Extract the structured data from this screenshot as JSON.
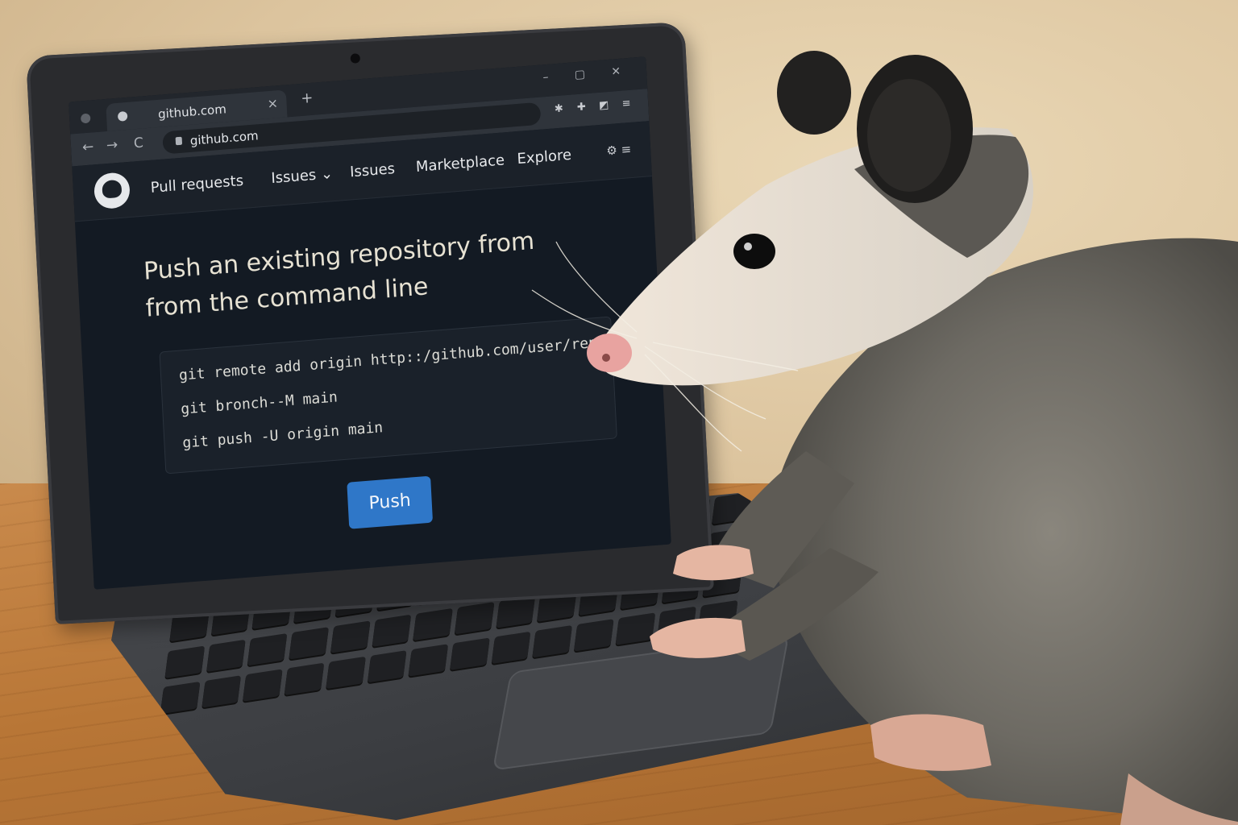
{
  "browser": {
    "tab_title": "github.com",
    "tab_close": "×",
    "new_tab": "+",
    "window_controls": "– ▢ ✕",
    "address": "github.com",
    "nav_back": "←",
    "nav_forward": "→",
    "nav_reload": "C"
  },
  "github_nav": {
    "items": [
      "Pull requests",
      "Issues ⌄",
      "Issues",
      "Marketplace",
      "Explore"
    ]
  },
  "main": {
    "title_line1": "Push an existing repository from",
    "title_line2": "from the command line",
    "code_lines": [
      "git remote add origin http::/github.com/user/repo.git",
      "git bronch--M main",
      "git push  -U origin main"
    ],
    "push_label": "Push"
  },
  "colors": {
    "screen_bg": "#131a23",
    "push_button": "#2f77c8",
    "title_text": "#e7e2d3",
    "opossum_fur": "#6d6a63",
    "opossum_face": "#ece6da"
  },
  "icons": [
    "github-logo-icon",
    "lock-icon",
    "settings-icon",
    "close-icon",
    "back-icon",
    "forward-icon",
    "reload-icon"
  ]
}
